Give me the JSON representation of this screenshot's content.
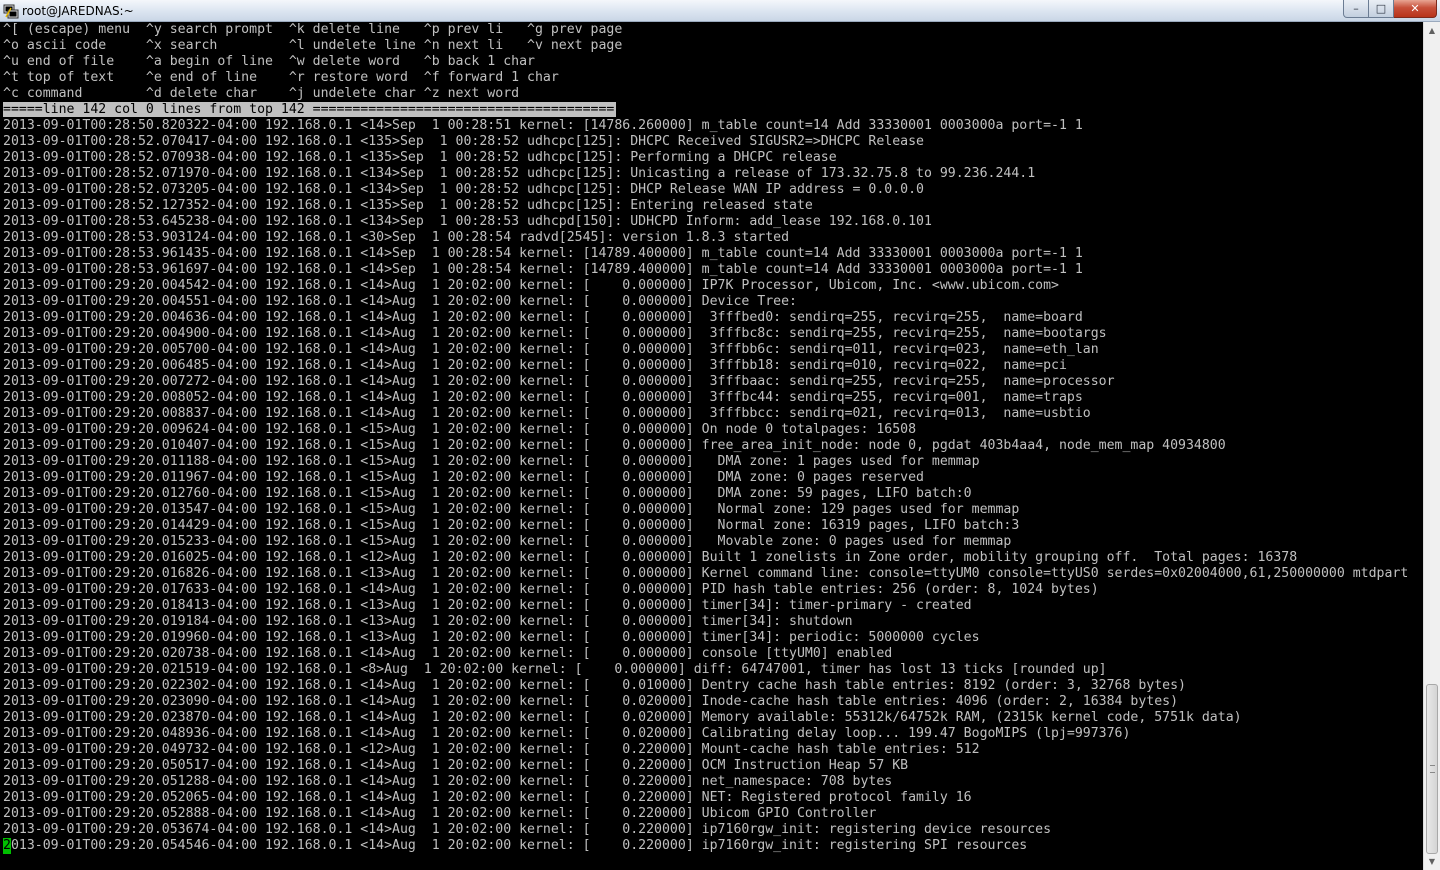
{
  "window": {
    "title": "root@JAREDNAS:~",
    "minimize_glyph": "–",
    "maximize_glyph": "□",
    "close_glyph": "✕"
  },
  "terminal": {
    "lines": [
      "^[ (escape) menu  ^y search prompt  ^k delete line   ^p prev li   ^g prev page",
      "^o ascii code     ^x search         ^l undelete line ^n next li   ^v next page",
      "^u end of file    ^a begin of line  ^w delete word   ^b back 1 char",
      "^t top of text    ^e end of line    ^r restore word  ^f forward 1 char",
      "^c command        ^d delete char    ^j undelete char ^z next word",
      "=====line 142 col 0 lines from top 142 ======================================",
      "2013-09-01T00:28:50.820322-04:00 192.168.0.1 <14>Sep  1 00:28:51 kernel: [14786.260000] m_table count=14 Add 33330001 0003000a port=-1 1",
      "2013-09-01T00:28:52.070417-04:00 192.168.0.1 <135>Sep  1 00:28:52 udhcpc[125]: DHCPC Received SIGUSR2=>DHCPC Release",
      "2013-09-01T00:28:52.070938-04:00 192.168.0.1 <135>Sep  1 00:28:52 udhcpc[125]: Performing a DHCPC release",
      "2013-09-01T00:28:52.071970-04:00 192.168.0.1 <134>Sep  1 00:28:52 udhcpc[125]: Unicasting a release of 173.32.75.8 to 99.236.244.1",
      "2013-09-01T00:28:52.073205-04:00 192.168.0.1 <134>Sep  1 00:28:52 udhcpc[125]: DHCP Release WAN IP address = 0.0.0.0",
      "2013-09-01T00:28:52.127352-04:00 192.168.0.1 <135>Sep  1 00:28:52 udhcpc[125]: Entering released state",
      "2013-09-01T00:28:53.645238-04:00 192.168.0.1 <134>Sep  1 00:28:53 udhcpd[150]: UDHCPD Inform: add_lease 192.168.0.101",
      "2013-09-01T00:28:53.903124-04:00 192.168.0.1 <30>Sep  1 00:28:54 radvd[2545]: version 1.8.3 started",
      "2013-09-01T00:28:53.961435-04:00 192.168.0.1 <14>Sep  1 00:28:54 kernel: [14789.400000] m_table count=14 Add 33330001 0003000a port=-1 1",
      "2013-09-01T00:28:53.961697-04:00 192.168.0.1 <14>Sep  1 00:28:54 kernel: [14789.400000] m_table count=14 Add 33330001 0003000a port=-1 1",
      "2013-09-01T00:29:20.004542-04:00 192.168.0.1 <14>Aug  1 20:02:00 kernel: [    0.000000] IP7K Processor, Ubicom, Inc. <www.ubicom.com>",
      "2013-09-01T00:29:20.004551-04:00 192.168.0.1 <14>Aug  1 20:02:00 kernel: [    0.000000] Device Tree:",
      "2013-09-01T00:29:20.004636-04:00 192.168.0.1 <14>Aug  1 20:02:00 kernel: [    0.000000]  3fffbed0: sendirq=255, recvirq=255,  name=board",
      "2013-09-01T00:29:20.004900-04:00 192.168.0.1 <14>Aug  1 20:02:00 kernel: [    0.000000]  3fffbc8c: sendirq=255, recvirq=255,  name=bootargs",
      "2013-09-01T00:29:20.005700-04:00 192.168.0.1 <14>Aug  1 20:02:00 kernel: [    0.000000]  3fffbb6c: sendirq=011, recvirq=023,  name=eth_lan",
      "2013-09-01T00:29:20.006485-04:00 192.168.0.1 <14>Aug  1 20:02:00 kernel: [    0.000000]  3fffbb18: sendirq=010, recvirq=022,  name=pci",
      "2013-09-01T00:29:20.007272-04:00 192.168.0.1 <14>Aug  1 20:02:00 kernel: [    0.000000]  3fffbaac: sendirq=255, recvirq=255,  name=processor",
      "2013-09-01T00:29:20.008052-04:00 192.168.0.1 <14>Aug  1 20:02:00 kernel: [    0.000000]  3fffbc44: sendirq=255, recvirq=001,  name=traps",
      "2013-09-01T00:29:20.008837-04:00 192.168.0.1 <14>Aug  1 20:02:00 kernel: [    0.000000]  3fffbbcc: sendirq=021, recvirq=013,  name=usbtio",
      "2013-09-01T00:29:20.009624-04:00 192.168.0.1 <15>Aug  1 20:02:00 kernel: [    0.000000] On node 0 totalpages: 16508",
      "2013-09-01T00:29:20.010407-04:00 192.168.0.1 <15>Aug  1 20:02:00 kernel: [    0.000000] free_area_init_node: node 0, pgdat 403b4aa4, node_mem_map 40934800",
      "2013-09-01T00:29:20.011188-04:00 192.168.0.1 <15>Aug  1 20:02:00 kernel: [    0.000000]   DMA zone: 1 pages used for memmap",
      "2013-09-01T00:29:20.011967-04:00 192.168.0.1 <15>Aug  1 20:02:00 kernel: [    0.000000]   DMA zone: 0 pages reserved",
      "2013-09-01T00:29:20.012760-04:00 192.168.0.1 <15>Aug  1 20:02:00 kernel: [    0.000000]   DMA zone: 59 pages, LIFO batch:0",
      "2013-09-01T00:29:20.013547-04:00 192.168.0.1 <15>Aug  1 20:02:00 kernel: [    0.000000]   Normal zone: 129 pages used for memmap",
      "2013-09-01T00:29:20.014429-04:00 192.168.0.1 <15>Aug  1 20:02:00 kernel: [    0.000000]   Normal zone: 16319 pages, LIFO batch:3",
      "2013-09-01T00:29:20.015233-04:00 192.168.0.1 <15>Aug  1 20:02:00 kernel: [    0.000000]   Movable zone: 0 pages used for memmap",
      "2013-09-01T00:29:20.016025-04:00 192.168.0.1 <12>Aug  1 20:02:00 kernel: [    0.000000] Built 1 zonelists in Zone order, mobility grouping off.  Total pages: 16378",
      "2013-09-01T00:29:20.016826-04:00 192.168.0.1 <13>Aug  1 20:02:00 kernel: [    0.000000] Kernel command line: console=ttyUM0 console=ttyUS0 serdes=0x02004000,61,250000000 mtdpart",
      "2013-09-01T00:29:20.017633-04:00 192.168.0.1 <14>Aug  1 20:02:00 kernel: [    0.000000] PID hash table entries: 256 (order: 8, 1024 bytes)",
      "2013-09-01T00:29:20.018413-04:00 192.168.0.1 <13>Aug  1 20:02:00 kernel: [    0.000000] timer[34]: timer-primary - created",
      "2013-09-01T00:29:20.019184-04:00 192.168.0.1 <13>Aug  1 20:02:00 kernel: [    0.000000] timer[34]: shutdown",
      "2013-09-01T00:29:20.019960-04:00 192.168.0.1 <13>Aug  1 20:02:00 kernel: [    0.000000] timer[34]: periodic: 5000000 cycles",
      "2013-09-01T00:29:20.020738-04:00 192.168.0.1 <14>Aug  1 20:02:00 kernel: [    0.000000] console [ttyUM0] enabled",
      "2013-09-01T00:29:20.021519-04:00 192.168.0.1 <8>Aug  1 20:02:00 kernel: [    0.000000] diff: 64747001, timer has lost 13 ticks [rounded up]",
      "2013-09-01T00:29:20.022302-04:00 192.168.0.1 <14>Aug  1 20:02:00 kernel: [    0.010000] Dentry cache hash table entries: 8192 (order: 3, 32768 bytes)",
      "2013-09-01T00:29:20.023090-04:00 192.168.0.1 <14>Aug  1 20:02:00 kernel: [    0.020000] Inode-cache hash table entries: 4096 (order: 2, 16384 bytes)",
      "2013-09-01T00:29:20.023870-04:00 192.168.0.1 <14>Aug  1 20:02:00 kernel: [    0.020000] Memory available: 55312k/64752k RAM, (2315k kernel code, 5751k data)",
      "2013-09-01T00:29:20.048936-04:00 192.168.0.1 <14>Aug  1 20:02:00 kernel: [    0.020000] Calibrating delay loop... 199.47 BogoMIPS (lpj=997376)",
      "2013-09-01T00:29:20.049732-04:00 192.168.0.1 <12>Aug  1 20:02:00 kernel: [    0.220000] Mount-cache hash table entries: 512",
      "2013-09-01T00:29:20.050517-04:00 192.168.0.1 <14>Aug  1 20:02:00 kernel: [    0.220000] OCM Instruction Heap 57 KB",
      "2013-09-01T00:29:20.051288-04:00 192.168.0.1 <14>Aug  1 20:02:00 kernel: [    0.220000] net_namespace: 708 bytes",
      "2013-09-01T00:29:20.052065-04:00 192.168.0.1 <14>Aug  1 20:02:00 kernel: [    0.220000] NET: Registered protocol family 16",
      "2013-09-01T00:29:20.052888-04:00 192.168.0.1 <14>Aug  1 20:02:00 kernel: [    0.220000] Ubicom GPIO Controller",
      "2013-09-01T00:29:20.053674-04:00 192.168.0.1 <14>Aug  1 20:02:00 kernel: [    0.220000] ip7160rgw_init: registering device resources"
    ],
    "cursor_char": "2",
    "last_line_rest": "013-09-01T00:29:20.054546-04:00 192.168.0.1 <14>Aug  1 20:02:00 kernel: [    0.220000] ip7160rgw_init: registering SPI resources"
  },
  "scrollbar": {
    "up_glyph": "▲",
    "down_glyph": "▼",
    "position_fraction": 0.78
  },
  "colors": {
    "terminal_bg": "#000000",
    "terminal_fg": "#c0c0c0",
    "status_bar_bg": "#c0c0c0",
    "cursor": "#00c000"
  }
}
